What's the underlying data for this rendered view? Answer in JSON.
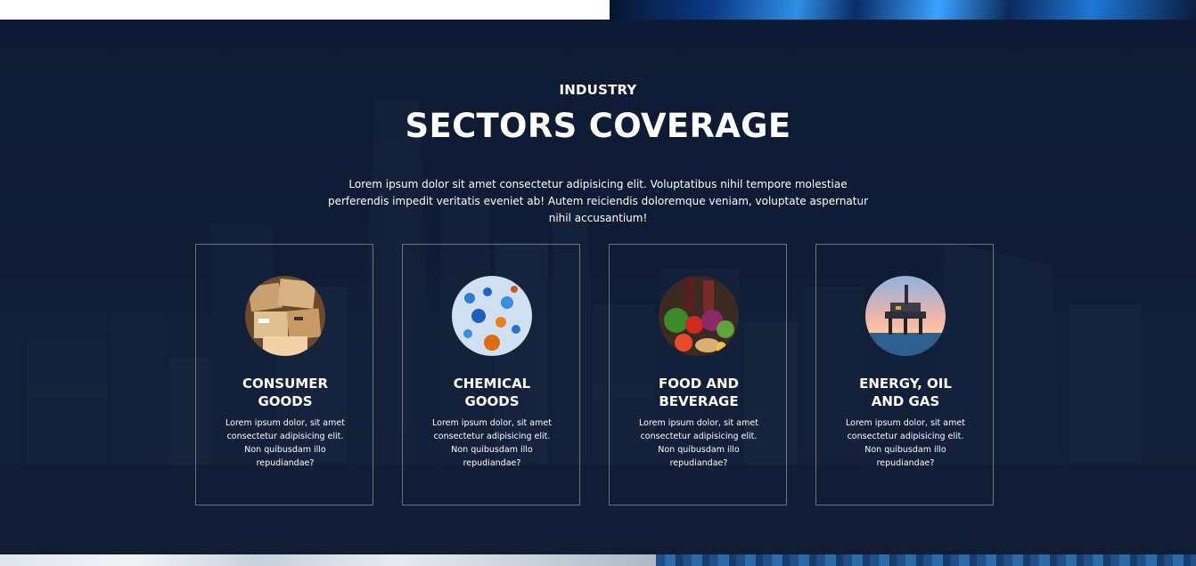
{
  "section": {
    "eyebrow": "INDUSTRY",
    "title": "SECTORS COVERAGE",
    "lead": "Lorem ipsum dolor sit amet consectetur adipisicing elit. Voluptatibus nihil tempore molestiae perferendis impedit veritatis eveniet ab! Autem reiciendis doloremque veniam, voluptate aspernatur nihil accusantium!"
  },
  "cards": [
    {
      "line1": "CONSUMER",
      "line2": "GOODS",
      "desc": "Lorem ipsum dolor, sit amet consectetur adipisicing elit. Non quibusdam illo repudiandae?",
      "image": "cardboard-boxes-image"
    },
    {
      "line1": "CHEMICAL",
      "line2": "GOODS",
      "desc": "Lorem ipsum dolor, sit amet consectetur adipisicing elit. Non quibusdam illo repudiandae?",
      "image": "liquid-droplets-image"
    },
    {
      "line1": "FOOD AND",
      "line2": "BEVERAGE",
      "desc": "Lorem ipsum dolor, sit amet consectetur adipisicing elit. Non quibusdam illo repudiandae?",
      "image": "groceries-image"
    },
    {
      "line1": "ENERGY, OIL",
      "line2": "AND GAS",
      "desc": "Lorem ipsum dolor, sit amet consectetur adipisicing elit. Non quibusdam illo repudiandae?",
      "image": "oil-platform-image"
    }
  ],
  "colors": {
    "section_bg": "#0d1a33",
    "card_border": "#c8d2e0",
    "text": "#ffffff"
  }
}
